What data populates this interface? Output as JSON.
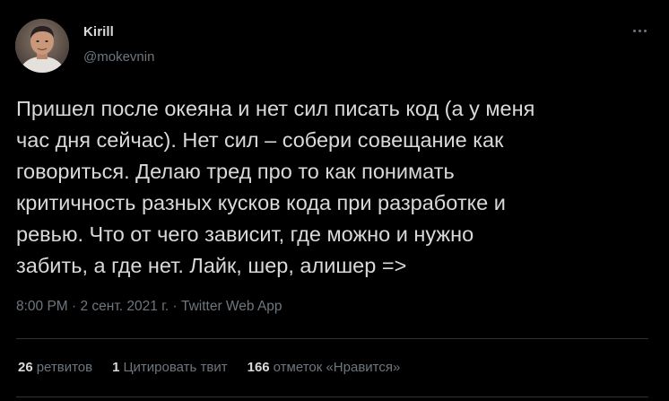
{
  "author": {
    "display_name": "Kirill",
    "handle": "@mokevnin"
  },
  "tweet": {
    "text": "Пришел после океяна и нет сил писать код (а у меня\nчас дня сейчас). Нет сил – собери совещание как\nговориться. Делаю тред про то как понимать\nкритичность разных кусков кода при разработке и\nревью. Что от чего зависит, где можно и нужно\nзабить, а где нет. Лайк, шер, алишер =>",
    "timestamp": "8:00 PM · 2 сент. 2021 г. · Twitter Web App"
  },
  "stats": {
    "retweets_count": "26",
    "retweets_label": "ретвитов",
    "quotes_count": "1",
    "quotes_label": "Цитировать твит",
    "likes_count": "166",
    "likes_label": "отметок «Нравится»"
  },
  "icons": {
    "more": "more-dots-icon"
  },
  "colors": {
    "background": "#000000",
    "text": "#d9d9d9",
    "secondary": "#6e767d",
    "divider": "#2f3336"
  }
}
